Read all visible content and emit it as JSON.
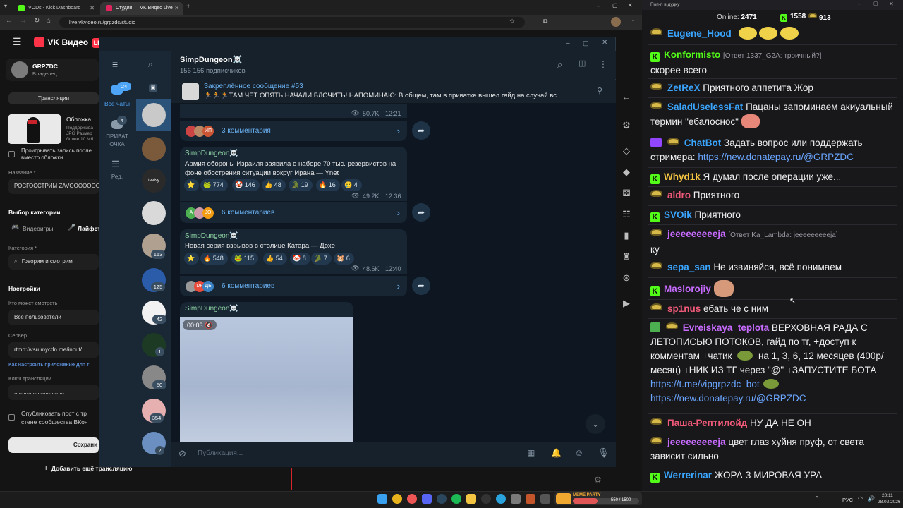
{
  "browser": {
    "tabs": [
      {
        "title": "VODs - Kick Dashboard",
        "color": "#53fc18"
      },
      {
        "title": "Студия — VK Видео Live",
        "color": "#e0245e"
      }
    ],
    "url": "live.vkvideo.ru/grpzdc/studio"
  },
  "vk": {
    "logo": "VK Видео",
    "live_badge": "LIVE",
    "channel_name": "GRPZDC",
    "channel_role": "Владелец",
    "tab_broadcasts": "Трансляции",
    "cover_label": "Обложка",
    "cover_hint_1": "Поддержива",
    "cover_hint_2": "JPG Размер",
    "cover_hint_3": "более 10 Мб",
    "play_record": "Проигрывать запись после",
    "play_record_2": "вместо обложки",
    "title_label": "Название *",
    "title_value": "РОСГОССТРИМ ZAVOOOOOOOD",
    "category_choice": "Выбор категории",
    "cat_games": "Видеоигры",
    "cat_life": "Лайфст",
    "category_label": "Категория *",
    "category_value": "Говорим и смотрим",
    "settings": "Настройки",
    "who_watch": "Кто может смотреть",
    "who_watch_value": "Все пользователи",
    "server_label": "Сервер",
    "server_value": "rtmp://vsu.mycdn.me/input/",
    "setup_link": "Как настроить приложение для т",
    "key_label": "Ключ трансляции",
    "key_value": "................................",
    "publish_1": "Опубликовать пост с тр",
    "publish_2": "стене сообщества ВКон",
    "save": "Сохрани",
    "add_more": "Добавить ещё трансляцию"
  },
  "tg": {
    "nav": [
      {
        "label": "Все чаты",
        "badge": "24"
      },
      {
        "label": "ПРИВАТ ОЧКА",
        "badge": "4"
      },
      {
        "label": "Ред.",
        "badge": ""
      }
    ],
    "chat_badges": [
      "153",
      "125",
      "42",
      "1",
      "50",
      "354",
      "2"
    ],
    "channel_name": "SimpDungeon☠️",
    "subscribers": "156 156 подписчиков",
    "pinned_title": "Закреплённое сообщение #53",
    "pinned_text": "🏃🏃🏃ТАМ ЧЕТ ОПЯТЬ НАЧАЛИ БЛОЧИТЬ! НАПОМИНАЮ:  В общем, там в приватке вышел гайд на случай вс...",
    "messages": [
      {
        "views": "50.7K",
        "time": "12:21",
        "comments": "3 комментария"
      },
      {
        "author": "SimpDungeon☠️",
        "text": "Армия обороны Израиля заявила о наборе 70 тыс. резервистов на фоне обострения ситуации вокруг Ирана — Ynet",
        "reactions": [
          "⭐",
          "🐸 774",
          "🤡 146",
          "👍 48",
          "🐊 19",
          "🔥 16",
          "😢 4"
        ],
        "views": "49.2K",
        "time": "12:36",
        "comments": "6 комментариев"
      },
      {
        "author": "SimpDungeon☠️",
        "text": "Новая серия взрывов в столице Катара — Дохе",
        "reactions": [
          "⭐",
          "🔥 548",
          "🐸 115",
          "👍 54",
          "🤡 8",
          "🐊 7",
          "🐹 6"
        ],
        "views": "48.6K",
        "time": "12:40",
        "comments": "6 комментариев"
      },
      {
        "author": "SimpDungeon☠️",
        "video_time": "00:03"
      }
    ],
    "composer_placeholder": "Публикация..."
  },
  "chat": {
    "window_title": "Поп-п в дудку",
    "online_label": "Online:",
    "online": "2471",
    "kick_count": "1558",
    "other_count": "913",
    "lines": [
      {
        "user": "Eugene_Hood",
        "color": "#3aa5ff",
        "text": ""
      },
      {
        "user": "Konformisto",
        "color": "#53fc18",
        "reply": "[Ответ 1337_G2A: троичный?]",
        "text": "скорее всего"
      },
      {
        "user": "ZetReX",
        "color": "#3aa5ff",
        "text": "Приятного аппетита Жор"
      },
      {
        "user": "SaladUselessFat",
        "color": "#3aa5ff",
        "text": "Пацаны запоминаем акиуальный термин \"ебалоснос\""
      },
      {
        "user": "ChatBot",
        "color": "#3aa5ff",
        "text": "Задать вопрос или поддержать стримера:",
        "link": "https://new.donatepay.ru/@GRPZDC"
      },
      {
        "user": "Whyd1k",
        "color": "#f5c542",
        "text": "Я думал после операции уже..."
      },
      {
        "user": "aldro",
        "color": "#f05a78",
        "text": "Приятного"
      },
      {
        "user": "SVOik",
        "color": "#3aa5ff",
        "text": "Приятного"
      },
      {
        "user": "jeeeeeeeeeja",
        "color": "#c86bff",
        "reply": "[Ответ Ka_Lambda: jeeeeeeeeeja]",
        "text": "ку"
      },
      {
        "user": "sepa_san",
        "color": "#3aa5ff",
        "text": "Не извиняйся, всё понимаем"
      },
      {
        "user": "Maslorojiy",
        "color": "#c86bff",
        "text": ""
      },
      {
        "user": "sp1nus",
        "color": "#f05a78",
        "text": "ебать че с ним"
      },
      {
        "user": "Evreiskaya_teplota",
        "color": "#c86bff",
        "text": "ВЕРХОВНАЯ РАДА С ЛЕТОПИСЬЮ ПОТОКОВ, гайд по тг, +доступ к комментам +чатик",
        "text2": "на 1, 3, 6, 12 месяцев (400р/месяц) +НИК ИЗ ТГ через \"@\" +ЗАПУСТИТЕ БОТА",
        "link": "https://t.me/vipgrpzdc_bot",
        "link2": "https://new.donatepay.ru/@GRPZDC"
      },
      {
        "user": "Паша-Рептилойд",
        "color": "#f05a78",
        "text": "НУ ДА НЕ ОН"
      },
      {
        "user": "jeeeeeeeeeja",
        "color": "#c86bff",
        "text": "цвет глаз хуйня пруф, от света зависит сильно"
      },
      {
        "user": "Werrerinar",
        "color": "#3aa5ff",
        "text": "ЖОРА З МИРОВАЯ УРА"
      }
    ]
  },
  "taskbar": {
    "meme": "MEME PARTY",
    "meme_count": "550 / 1500",
    "lang": "РУС",
    "time": "20:11",
    "date": "28.02.2026"
  }
}
